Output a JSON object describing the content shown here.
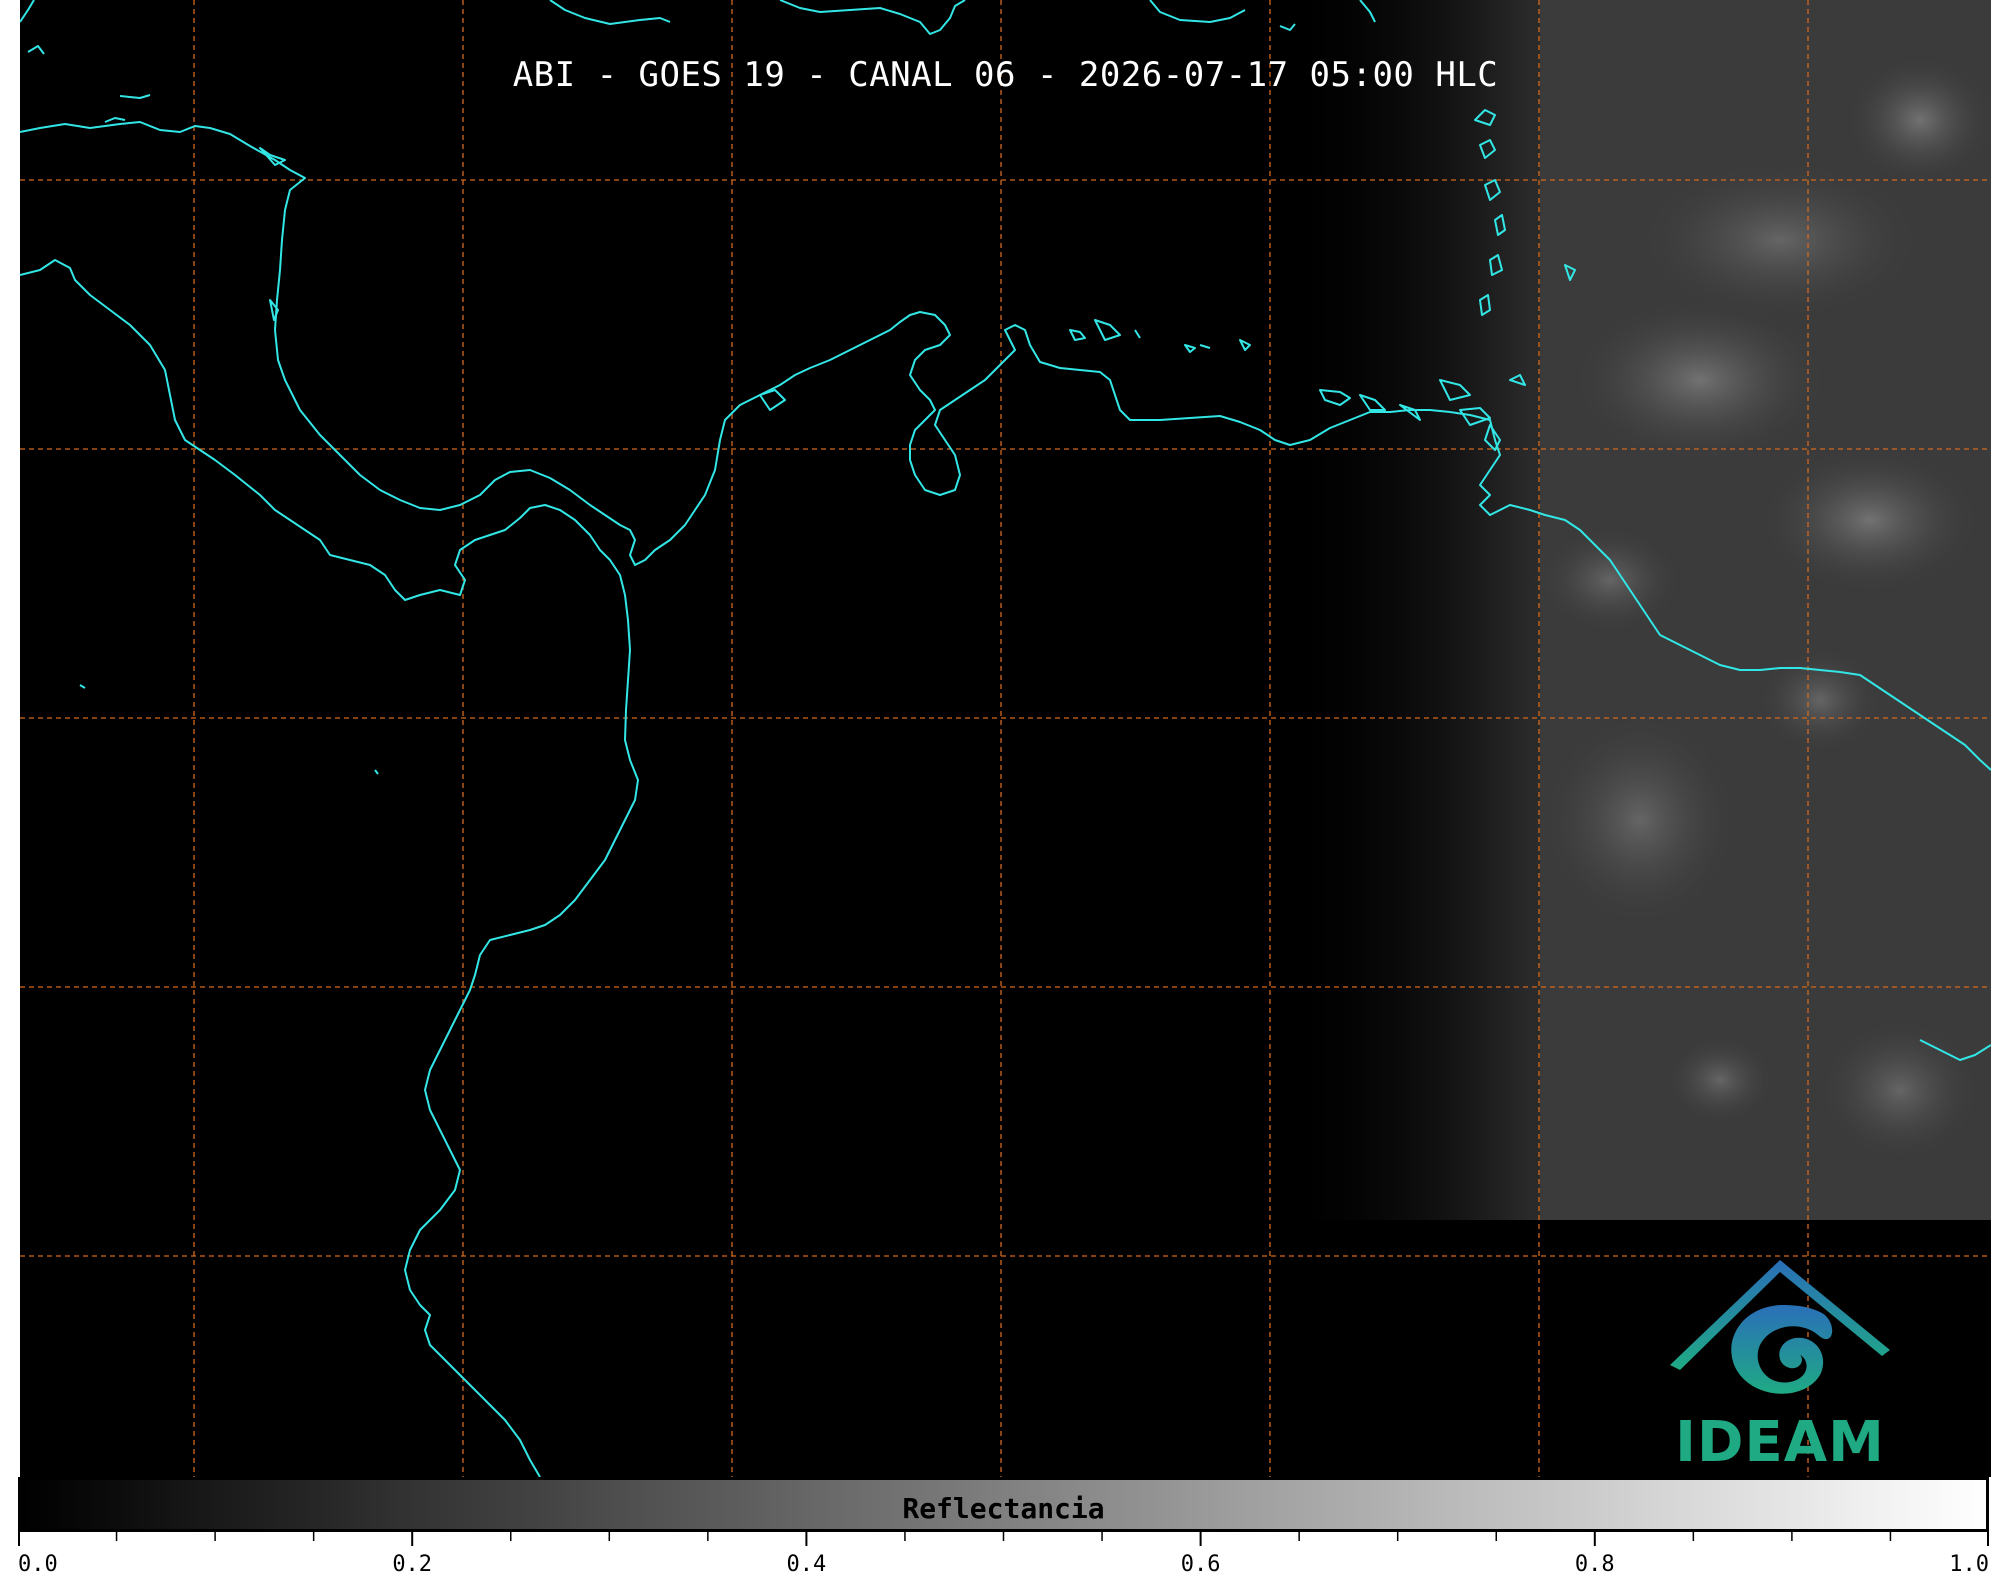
{
  "title": "ABI - GOES 19 - CANAL 06 - 2026-07-17 05:00 HLC",
  "logo": {
    "text": "IDEAM",
    "colors": [
      "#2a7fb8",
      "#1faa84"
    ]
  },
  "colorbar": {
    "label": "Reflectancia",
    "range": [
      0.0,
      1.0
    ],
    "tick_labels": [
      "0.0",
      "0.2",
      "0.4",
      "0.6",
      "0.8",
      "1.0"
    ],
    "colormap": [
      "#000000",
      "#ffffff"
    ]
  },
  "map": {
    "background": "#000000",
    "coastline_color": "#33e6e6",
    "gridline_color": "#d2691e",
    "gridline_style": "dashed",
    "cloud_region": "east"
  }
}
